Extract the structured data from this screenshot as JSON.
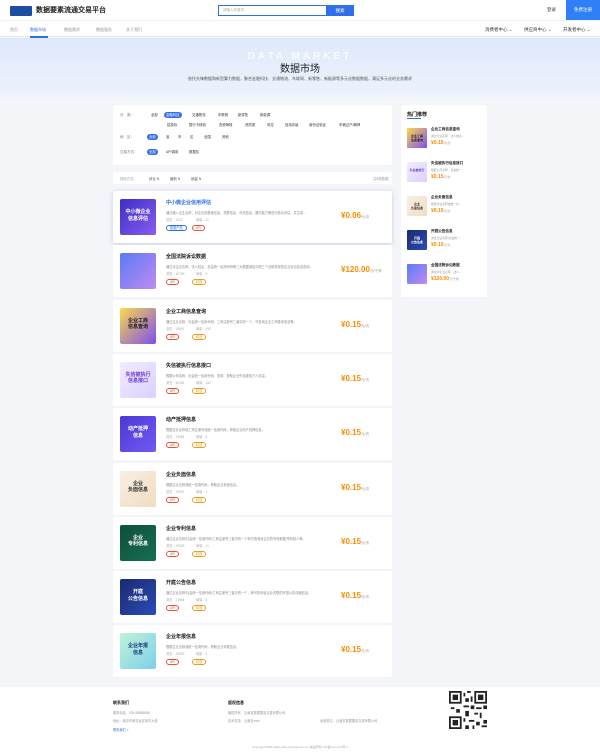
{
  "header": {
    "title": "数据要素流通交易平台",
    "search_placeholder": "请输入关键词",
    "search_btn": "搜索",
    "login": "登录",
    "register": "免费注册"
  },
  "nav": {
    "items": [
      "首页",
      "数据市场",
      "数据需求",
      "数据服务",
      "关于我们"
    ],
    "active": "数据市场",
    "right": [
      "消费者中心 ⌄",
      "供应商中心 ⌄",
      "开发者中心 ⌄"
    ]
  },
  "hero": {
    "watermark": "DATA MARKET",
    "title": "数据市场",
    "subtitle": "依托先锋数据和新型算力数据，聚合金融科技、交通物流、车联网、新零售、新能源等多元化数据数据，满足多元化的业务需求"
  },
  "filters": {
    "category_label": "分　类：",
    "category": [
      "全部",
      "金融科技",
      "交通物流",
      "车联网",
      "新零售",
      "新能源"
    ],
    "sub": [
      "招投标",
      "银行卡核验",
      "查税审核",
      "资质类",
      "风控",
      "信用评级",
      "身份证验证",
      "车辆过户/解押"
    ],
    "region_label": "地　区：",
    "region": [
      "全部",
      "省",
      "市",
      "区",
      "全国",
      "其他"
    ],
    "type_label": "交易方式：",
    "type": [
      "全部",
      "API调用",
      "数据包"
    ]
  },
  "sort": {
    "label": "排序方式：",
    "options": [
      "综合 ⇅",
      "最新 ⇅",
      "销量 ⇅"
    ],
    "count": "共8条数据"
  },
  "products": [
    {
      "thumb": "中小微企业\n信息评估",
      "title": "中小微企业信用评估",
      "desc": "通过输入企业名称，对企业的基础信息、关联信息、司法信息、履约能力等进行综合评估，并生成...",
      "views": "浏览：1372",
      "sales": "销量：11",
      "tags": [
        "数据产品",
        "API"
      ],
      "price": "¥0.06",
      "unit": "元/次"
    },
    {
      "thumb": "",
      "title": "全国法院诉讼数据",
      "desc": "通过对企业名称、法人姓名、社会统一信用代码等三大数据源及中国三个法院系统的企业诉讼信息查询...",
      "views": "浏览：10769",
      "sales": "销量：9",
      "tags": [
        "API",
        "精选"
      ],
      "price": "¥120.00",
      "unit": "元/千条"
    },
    {
      "thumb": "企业工商\n信息查询",
      "title": "企业工商信息查询",
      "desc": "通过企业名称、社会统一信用代码、工商注册号三者中的一个，可查询企业工商基本信息等。",
      "views": "浏览：19801",
      "sales": "销量：192",
      "tags": [
        "API",
        "精选"
      ],
      "price": "¥0.15",
      "unit": "元/次"
    },
    {
      "thumb": "失信被执行\n信息接口",
      "title": "失信被执行信息接口",
      "desc": "根据公司名称、社会统一信用代码、查询、获取企业失信被执行人信息。",
      "views": "浏览：40116",
      "sales": "销量：162",
      "tags": [
        "API",
        "精选"
      ],
      "price": "¥0.15",
      "unit": "元/次"
    },
    {
      "thumb": "动产抵押\n信息",
      "title": "动产抵押信息",
      "desc": "根据企业名称或工商注册号或统一信用代码，获取企业动产抵押信息。",
      "views": "浏览：23964",
      "sales": "销量：5",
      "tags": [
        "API",
        "精选"
      ],
      "price": "¥0.15",
      "unit": "元/次"
    },
    {
      "thumb": "企业\n负面信息",
      "title": "企业负面信息",
      "desc": "根据企业名称或统一信用代码，获取企业负面信息。",
      "views": "浏览：20097",
      "sales": "销量：4",
      "tags": [
        "API",
        "精选"
      ],
      "price": "¥0.15",
      "unit": "元/次"
    },
    {
      "thumb": "企业\n专利信息",
      "title": "企业专利信息",
      "desc": "通过企业名称/社会统一信用代码/工商注册号三者中的一个即可查询该企业的专利数据/专利权人等...",
      "views": "浏览：20039",
      "sales": "销量：11",
      "tags": [
        "API",
        "精选"
      ],
      "price": "¥0.15",
      "unit": "元/次"
    },
    {
      "thumb": "开庭\n公告信息",
      "title": "开庭公告信息",
      "desc": "通过企业名称/社会统一信用代码/工商注册号三者中的一个，即可查询该企业关联的开庭公告详细信息。",
      "views": "浏览：21964",
      "sales": "销量：5",
      "tags": [
        "API",
        "精选"
      ],
      "price": "¥0.15",
      "unit": "元/次"
    },
    {
      "thumb": "企业年报\n信息",
      "title": "企业年报信息",
      "desc": "根据企业名称或统一信用代码，获取企业年报信息。",
      "views": "浏览：20603",
      "sales": "销量：3",
      "tags": [
        "API",
        "精选"
      ],
      "price": "¥0.15",
      "unit": "元/次"
    }
  ],
  "side": {
    "title": "热门推荐",
    "items": [
      {
        "thumb": "企业工商\n信息查询",
        "title": "企业工商信息查询",
        "desc": "通过企业名称、法人姓名...",
        "price": "¥0.15",
        "unit": "元/次"
      },
      {
        "thumb": "失信被执行",
        "title": "失信被执行信息接口",
        "desc": "根据公司名称、社会统一...",
        "price": "¥0.15",
        "unit": "元/次"
      },
      {
        "thumb": "企业\n负面信息",
        "title": "企业负面信息",
        "desc": "根据企业名称或统一信...",
        "price": "¥0.15",
        "unit": "元/次"
      },
      {
        "thumb": "开庭\n公告信息",
        "title": "开庭公告信息",
        "desc": "通过企业名称/社会统一...",
        "price": "¥0.15",
        "unit": "元/次"
      },
      {
        "thumb": "",
        "title": "全国法院诉讼数据",
        "desc": "通过对企业名称、法人...",
        "price": "¥120.00",
        "unit": "元/千条"
      }
    ]
  },
  "footer": {
    "contact_title": "联系我们",
    "phone": "服务电话：025-88888888",
    "address": "地址：南京市雨花台区软件大道",
    "more": "联系我们 >",
    "ops_title": "版权信息",
    "op1": "版权所有：云南省数据要素交易有限公司",
    "op2": "技术支持：云南省xxxx",
    "op3": "运营单位：云南省数据要素交易有限公司",
    "copyright": "Copyright 2020-2022 www.xxxdata.com.cn  版权所有 ICP备xxxxxxxx号-1"
  },
  "colors": {
    "primary": "#2f6fe8",
    "price": "#ff8b00"
  }
}
